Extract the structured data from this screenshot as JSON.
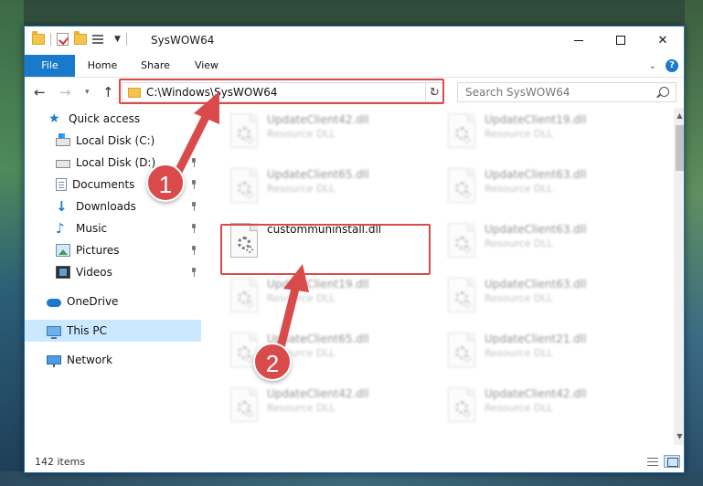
{
  "window": {
    "title": "SysWOW64",
    "controls": {
      "minimize": "–",
      "maximize": "☐",
      "close": "✕"
    }
  },
  "ribbon": {
    "tabs": [
      {
        "label": "File"
      },
      {
        "label": "Home"
      },
      {
        "label": "Share"
      },
      {
        "label": "View"
      }
    ],
    "help": "?",
    "collapse": "⌄"
  },
  "nav": {
    "back": "←",
    "forward": "→",
    "recent": "▾",
    "up": "↑",
    "address": "C:\\Windows\\SysWOW64",
    "address_dropdown": "⌄",
    "refresh": "↻",
    "search_placeholder": "Search SysWOW64"
  },
  "sidebar": {
    "items": [
      {
        "label": "Quick access",
        "icon": "star-icon",
        "pinned": false
      },
      {
        "label": "Local Disk (C:)",
        "icon": "windows-drive-icon",
        "pinned": true
      },
      {
        "label": "Local Disk (D:)",
        "icon": "drive-icon",
        "pinned": true
      },
      {
        "label": "Documents",
        "icon": "documents-icon",
        "pinned": true
      },
      {
        "label": "Downloads",
        "icon": "downloads-icon",
        "pinned": true
      },
      {
        "label": "Music",
        "icon": "music-icon",
        "pinned": true
      },
      {
        "label": "Pictures",
        "icon": "pictures-icon",
        "pinned": true
      },
      {
        "label": "Videos",
        "icon": "videos-icon",
        "pinned": true
      },
      {
        "label": "OneDrive",
        "icon": "onedrive-icon",
        "pinned": false
      },
      {
        "label": "This PC",
        "icon": "this-pc-icon",
        "pinned": false,
        "selected": true
      },
      {
        "label": "Network",
        "icon": "network-icon",
        "pinned": false
      }
    ]
  },
  "files": [
    {
      "name": "UpdateClient42.dll",
      "type": "Resource DLL",
      "blurred": true
    },
    {
      "name": "UpdateClient19.dll",
      "type": "Resource DLL",
      "blurred": true
    },
    {
      "name": "UpdateClient65.dll",
      "type": "Resource DLL",
      "blurred": true
    },
    {
      "name": "UpdateClient63.dll",
      "type": "Resource DLL",
      "blurred": true
    },
    {
      "name": "custommuninstall.dll",
      "type": "",
      "blurred": false
    },
    {
      "name": "UpdateClient63.dll",
      "type": "Resource DLL",
      "blurred": true
    },
    {
      "name": "UpdateClient19.dll",
      "type": "Resource DLL",
      "blurred": true
    },
    {
      "name": "UpdateClient63.dll",
      "type": "Resource DLL",
      "blurred": true
    },
    {
      "name": "UpdateClient65.dll",
      "type": "Resource DLL",
      "blurred": true
    },
    {
      "name": "UpdateClient21.dll",
      "type": "Resource DLL",
      "blurred": true
    },
    {
      "name": "UpdateClient42.dll",
      "type": "Resource DLL",
      "blurred": true
    },
    {
      "name": "UpdateClient42.dll",
      "type": "Resource DLL",
      "blurred": true
    }
  ],
  "status": {
    "count": "142 items"
  },
  "annotations": [
    {
      "label": "1",
      "color": "#d94b4b"
    },
    {
      "label": "2",
      "color": "#d94b4b"
    }
  ]
}
